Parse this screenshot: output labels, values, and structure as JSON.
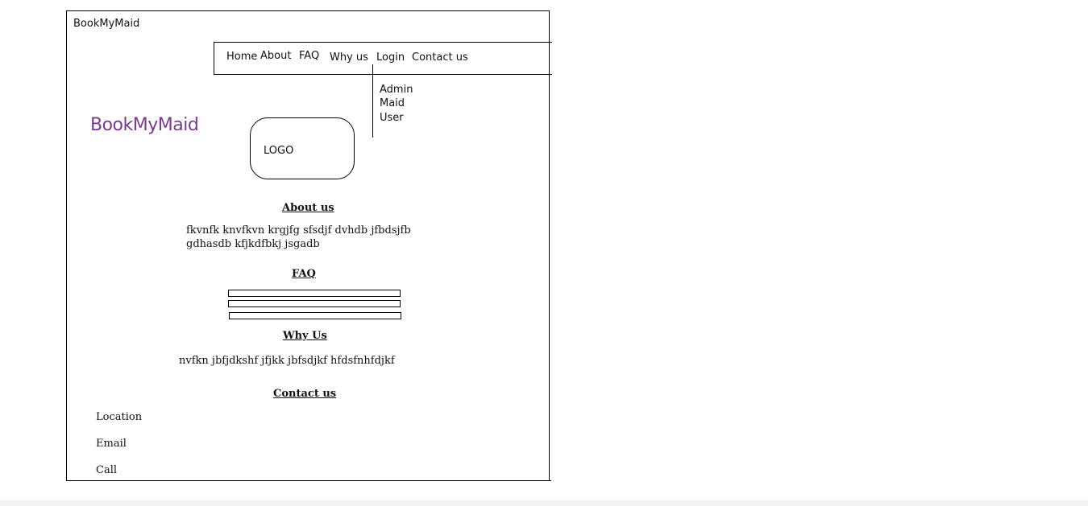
{
  "app": {
    "title": "BookMyMaid",
    "brand": "BookMyMaid",
    "brand_color": "#7b3a8e",
    "logo_label": "LOGO"
  },
  "nav": {
    "home": "Home",
    "about": "About",
    "faq": "FAQ",
    "why": "Why us",
    "login": "Login",
    "contact": "Contact us"
  },
  "login_menu": {
    "items": [
      "Admin",
      "Maid",
      "User"
    ]
  },
  "about": {
    "heading": "About us",
    "line1": "fkvnfk knvfkvn krgjfg sfsdjf dvhdb jfbdsjfb",
    "line2": "gdhasdb kfjkdfbkj jsgadb"
  },
  "faq": {
    "heading": "FAQ"
  },
  "why": {
    "heading": "Why Us",
    "text": "nvfkn jbfjdkshf jfjkk jbfsdjkf hfdsfnhfdjkf"
  },
  "contact": {
    "heading": "Contact us",
    "location": "Location",
    "email": "Email",
    "call": "Call"
  }
}
